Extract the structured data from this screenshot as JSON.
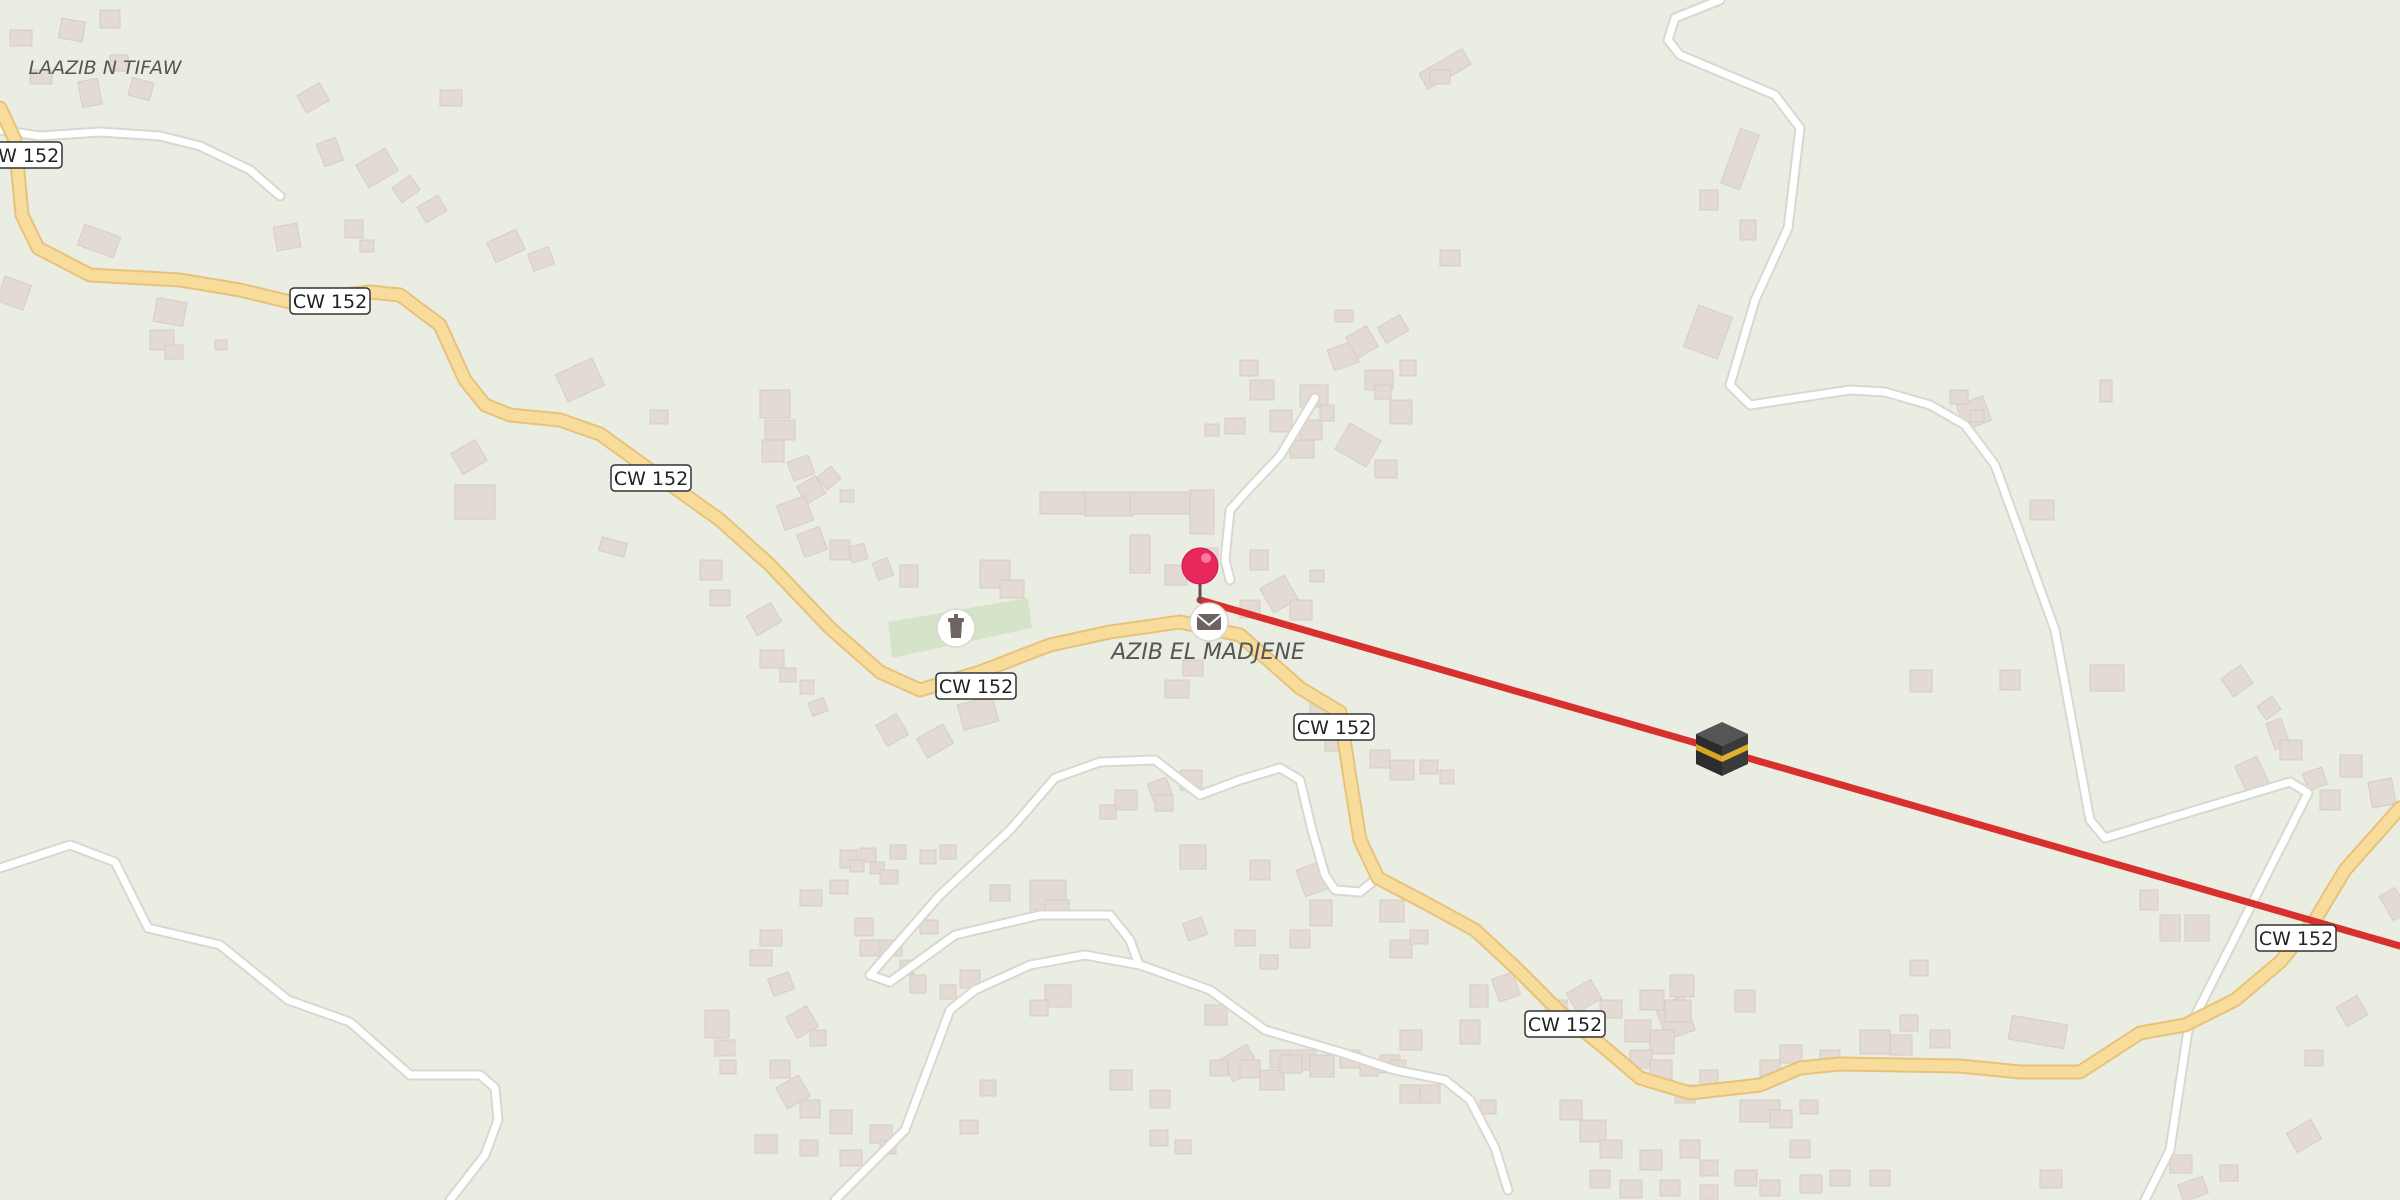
{
  "map": {
    "background": "#eaede2",
    "place_labels": {
      "village_main": "AZIB EL MADJENE",
      "village_nw": "LAAZIB N TIFAW"
    },
    "road_ref": "CW 152",
    "colors": {
      "primary_road": "#f8dc9c",
      "primary_road_casing": "#e8c27a",
      "minor_road": "#ffffff",
      "minor_road_casing": "#d8d8d0",
      "buildings": "#e3dbd3",
      "building_stroke": "#d6cdc4",
      "landuse_green": "#d5e3c8",
      "route_line": "#d8302c",
      "marker": "#e8285a"
    },
    "icons": {
      "pin": "map-pin-icon",
      "post_office": "envelope-icon",
      "cemetery": "cemetery-icon",
      "destination": "kaaba-icon"
    }
  }
}
